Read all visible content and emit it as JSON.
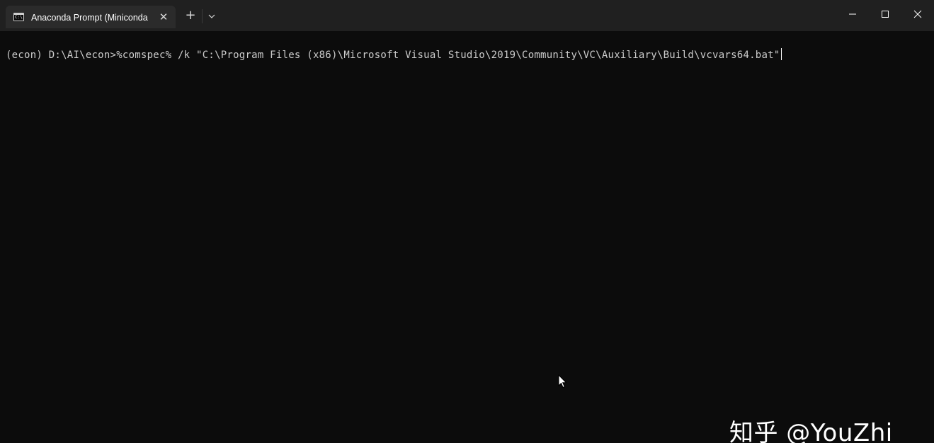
{
  "window": {
    "tab": {
      "icon": "terminal-icon",
      "icon_text": "C:\\",
      "title": "Anaconda Prompt (Miniconda",
      "close_icon": "close-icon"
    },
    "new_tab_icon": "plus-icon",
    "dropdown_icon": "chevron-down-icon",
    "controls": {
      "minimize_icon": "minimize-icon",
      "maximize_icon": "maximize-icon",
      "close_icon": "close-icon"
    }
  },
  "terminal": {
    "prompt": "(econ) D:\\AI\\econ>",
    "command": "%comspec% /k \"C:\\Program Files (x86)\\Microsoft Visual Studio\\2019\\Community\\VC\\Auxiliary\\Build\\vcvars64.bat\""
  },
  "watermark": {
    "text": "知乎 @YouZhi"
  },
  "colors": {
    "background": "#0c0c0c",
    "titlebar": "#202020",
    "tab_active": "#2b2b2b",
    "text": "#cccccc"
  }
}
